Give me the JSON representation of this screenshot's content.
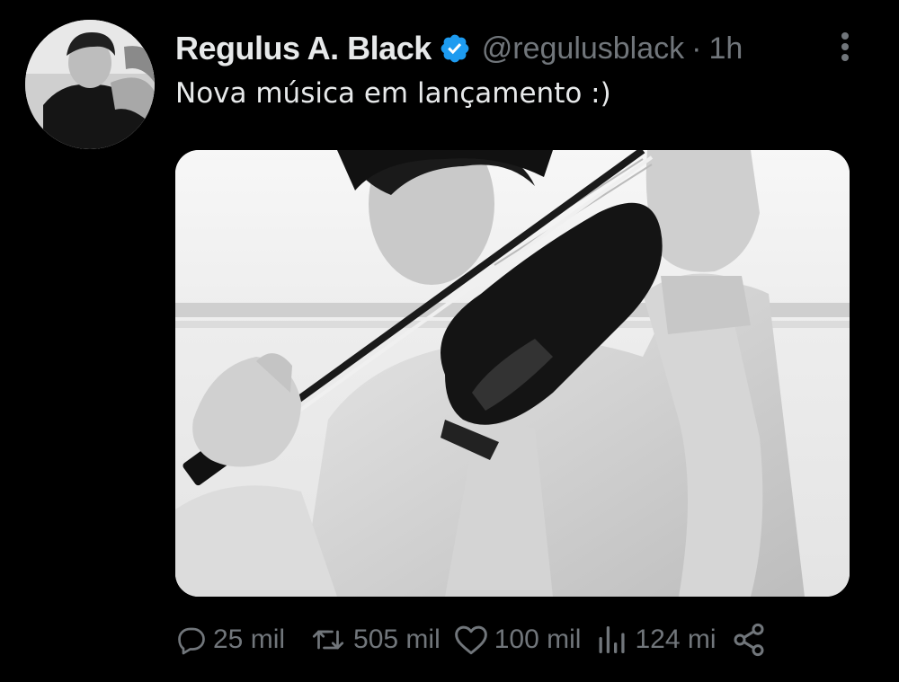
{
  "tweet": {
    "display_name": "Regulus A. Black",
    "handle": "@regulusblack",
    "separator": "·",
    "time": "1h",
    "text": "Nova música em lançamento :)"
  },
  "actions": {
    "replies": "25 mil",
    "retweets": "505 mil",
    "likes": "100 mil",
    "views": "124 mi"
  },
  "icons": {
    "verified": "verified-badge-icon",
    "more": "more-vertical-icon",
    "reply": "reply-icon",
    "retweet": "retweet-icon",
    "like": "heart-icon",
    "views": "views-chart-icon",
    "share": "share-icon"
  },
  "colors": {
    "background": "#000000",
    "text": "#e7e9ea",
    "muted": "#71767b",
    "verified": "#1d9bf0"
  }
}
